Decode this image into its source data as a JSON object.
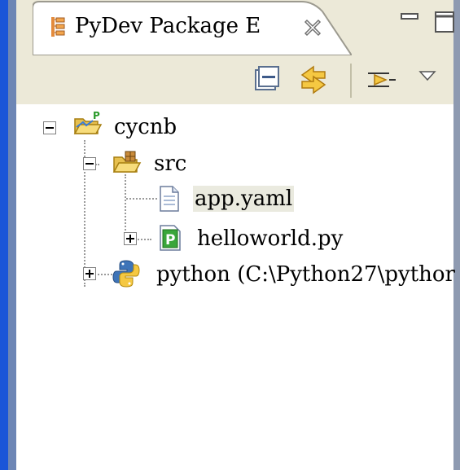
{
  "view_tab": {
    "title": "PyDev Package E",
    "icon": "package-explorer-icon",
    "close_icon": "close-icon"
  },
  "window_controls": {
    "minimize_icon": "minimize-icon",
    "maximize_icon": "maximize-icon"
  },
  "toolbar": {
    "collapse_all_icon": "collapse-all-icon",
    "link_with_editor_icon": "link-with-editor-icon",
    "filter_icon": "filter-icon",
    "view_menu_icon": "view-menu-icon"
  },
  "tree": {
    "project": {
      "label": "cycnb",
      "icon": "pydev-project-folder-icon",
      "expanded": true
    },
    "source_folder": {
      "label": "src",
      "icon": "source-folder-icon",
      "expanded": true
    },
    "file_app_yaml": {
      "label": "app.yaml",
      "icon": "text-file-icon",
      "selected": true
    },
    "file_helloworld": {
      "label": "helloworld.py",
      "icon": "python-module-icon",
      "expanded": false
    },
    "interpreter": {
      "label": "python  (C:\\Python27\\pythor",
      "icon": "python-interpreter-icon",
      "expanded": false
    }
  },
  "colors": {
    "tab_bg": "#ffffff",
    "strip_bg": "#ece9d8",
    "selection_bg": "#eaeadf",
    "frame_blue": "#1a55d8"
  }
}
